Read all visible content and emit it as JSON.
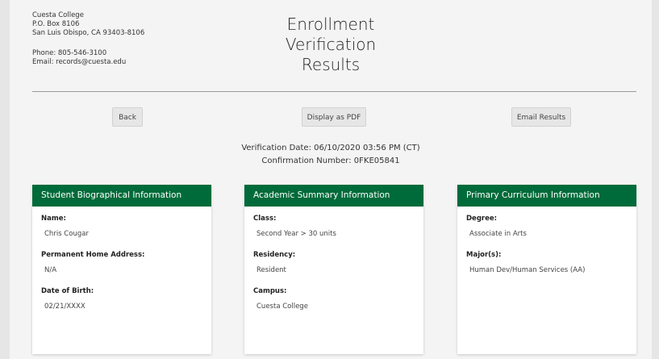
{
  "institution": {
    "name": "Cuesta College",
    "po_box": "P.O. Box 8106",
    "city_line": "San Luis Obispo, CA 93403-8106",
    "phone": "Phone: 805-546-3100",
    "email": "Email: records@cuesta.edu"
  },
  "title_lines": [
    "Enrollment",
    "Verification",
    "Results"
  ],
  "actions": {
    "back": "Back",
    "pdf": "Display as PDF",
    "email": "Email Results"
  },
  "verification": {
    "date": "Verification Date: 06/10/2020 03:56 PM (CT)",
    "confirmation": "Confirmation Number: 0FKE05841"
  },
  "cards": {
    "bio": {
      "header": "Student Biographical Information",
      "fields": [
        {
          "label": "Name:",
          "value": "Chris Cougar"
        },
        {
          "label": "Permanent Home Address:",
          "value": "N/A"
        },
        {
          "label": "Date of Birth:",
          "value": "02/21/XXXX"
        }
      ]
    },
    "academic": {
      "header": "Academic Summary Information",
      "fields": [
        {
          "label": "Class:",
          "value": "Second Year > 30 units"
        },
        {
          "label": "Residency:",
          "value": "Resident"
        },
        {
          "label": "Campus:",
          "value": "Cuesta College"
        }
      ]
    },
    "curriculum": {
      "header": "Primary Curriculum Information",
      "fields": [
        {
          "label": "Degree:",
          "value": "Associate in Arts"
        },
        {
          "label": "Major(s):",
          "value": "Human Dev/Human Services (AA)"
        }
      ]
    }
  },
  "colors": {
    "accent_green": "#006b3a",
    "page_bg": "#f4f4f4",
    "button_bg": "#e6e6e6"
  }
}
